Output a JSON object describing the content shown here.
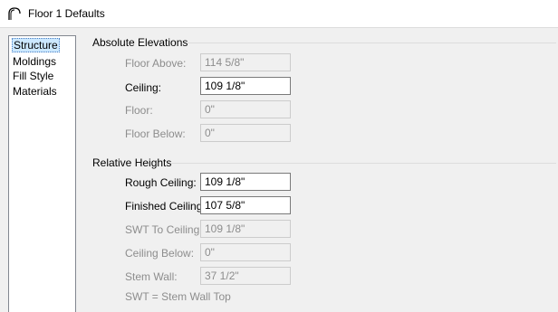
{
  "window": {
    "title": "Floor 1 Defaults",
    "icon": "arch-icon"
  },
  "nav": {
    "items": [
      {
        "label": "Structure",
        "selected": true
      },
      {
        "label": "Moldings",
        "selected": false
      },
      {
        "label": "Fill Style",
        "selected": false
      },
      {
        "label": "Materials",
        "selected": false
      }
    ]
  },
  "absolute": {
    "header": "Absolute Elevations",
    "rows": [
      {
        "label": "Floor Above:",
        "value": "114 5/8\"",
        "enabled": false
      },
      {
        "label": "Ceiling:",
        "value": "109 1/8\"",
        "enabled": true
      },
      {
        "label": "Floor:",
        "value": "0\"",
        "enabled": false
      },
      {
        "label": "Floor Below:",
        "value": "0\"",
        "enabled": false
      }
    ]
  },
  "relative": {
    "header": "Relative Heights",
    "rows": [
      {
        "label": "Rough Ceiling:",
        "value": "109 1/8\"",
        "enabled": true
      },
      {
        "label": "Finished Ceiling:",
        "value": "107 5/8\"",
        "enabled": true
      },
      {
        "label": "SWT To Ceiling:",
        "value": "109 1/8\"",
        "enabled": false
      },
      {
        "label": "Ceiling Below:",
        "value": "0\"",
        "enabled": false
      },
      {
        "label": "Stem Wall:",
        "value": "37 1/2\"",
        "enabled": false
      }
    ],
    "footnote": "SWT = Stem Wall Top"
  }
}
